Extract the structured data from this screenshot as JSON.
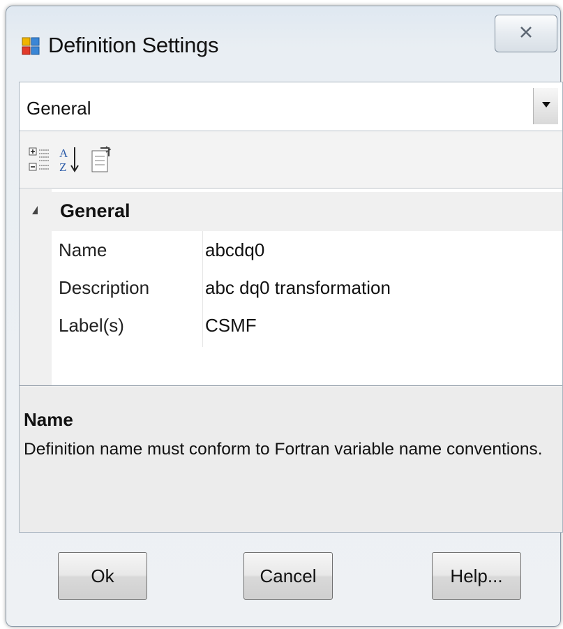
{
  "window": {
    "title": "Definition Settings",
    "icons": {
      "app": "definition-app-icon",
      "close": "close-icon"
    }
  },
  "category_select": {
    "value": "General",
    "icon": "chevron-down-icon"
  },
  "toolbar": {
    "buttons": [
      {
        "name": "categorized-view",
        "icon": "categorized-icon"
      },
      {
        "name": "alphabetical-sort",
        "icon": "sort-az-icon"
      },
      {
        "name": "property-pages",
        "icon": "property-pages-icon"
      }
    ]
  },
  "property_grid": {
    "category": "General",
    "rows": [
      {
        "name": "Name",
        "value": "abcdq0"
      },
      {
        "name": "Description",
        "value": "abc dq0 transformation"
      },
      {
        "name": "Label(s)",
        "value": "CSMF"
      }
    ]
  },
  "help_panel": {
    "title": "Name",
    "text": "Definition name must conform to Fortran variable name conventions."
  },
  "buttons": {
    "ok": "Ok",
    "cancel": "Cancel",
    "help": "Help..."
  },
  "colors": {
    "title_bar": "#dfe8f1",
    "grid_background": "#ffffff",
    "gutter": "#f0f0f0",
    "help_background": "#ececec"
  }
}
